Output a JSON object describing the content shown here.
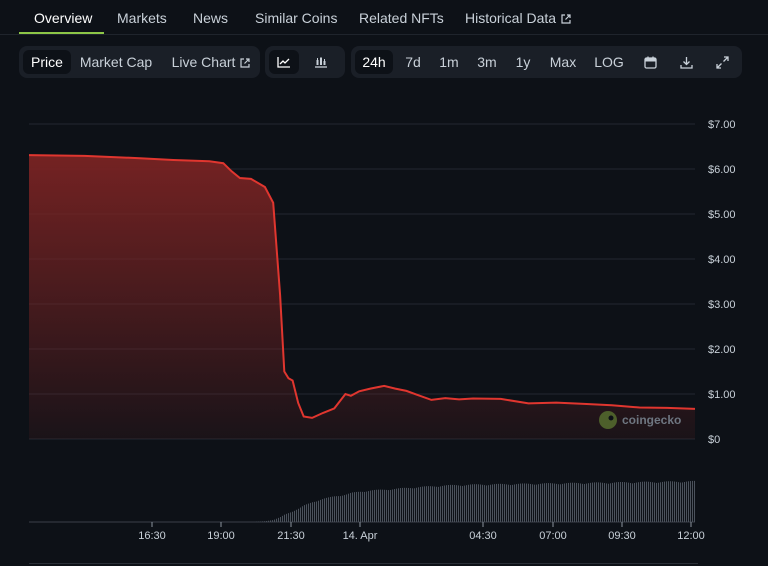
{
  "tabs": [
    {
      "label": "Overview",
      "active": true
    },
    {
      "label": "Markets"
    },
    {
      "label": "News"
    },
    {
      "label": "Similar Coins"
    },
    {
      "label": "Related NFTs"
    },
    {
      "label": "Historical Data",
      "external": true
    }
  ],
  "toolbar": {
    "metric_tabs": [
      "Price",
      "Market Cap",
      "Live Chart"
    ],
    "range_tabs": [
      "24h",
      "7d",
      "1m",
      "3m",
      "1y",
      "Max",
      "LOG"
    ],
    "icons": [
      "line-chart-icon",
      "candlestick-icon",
      "calendar-icon",
      "download-icon",
      "expand-icon"
    ]
  },
  "chart_data": {
    "type": "area",
    "title": "",
    "xlabel": "",
    "ylabel": "",
    "x_ticks": [
      "16:30",
      "19:00",
      "21:30",
      "14. Apr",
      "04:30",
      "07:00",
      "09:30",
      "12:00"
    ],
    "y_ticks": [
      "$7.00",
      "$6.00",
      "$5.00",
      "$4.00",
      "$3.00",
      "$2.00",
      "$1.00",
      "$0"
    ],
    "ylim": [
      0,
      7
    ],
    "y_axis_side": "right",
    "grid": true,
    "line_color": "#e0362f",
    "fill_color": "#7a2323",
    "watermark": "coingecko",
    "x_hours_from_start": [
      0,
      2,
      4,
      5.2,
      6.5,
      7.0,
      7.3,
      7.6,
      8.0,
      8.5,
      8.8,
      9.05,
      9.2,
      9.35,
      9.5,
      9.7,
      9.9,
      10.2,
      10.6,
      11.0,
      11.4,
      11.6,
      11.9,
      12.3,
      12.8,
      13.2,
      13.6,
      14.0,
      14.5,
      15.0,
      15.5,
      16.0,
      17.0,
      18.0,
      19.0,
      20.0,
      21.0,
      22.0,
      23.0,
      24.0
    ],
    "series": [
      {
        "values": [
          6.31,
          6.29,
          6.24,
          6.2,
          6.17,
          6.13,
          5.95,
          5.8,
          5.78,
          5.6,
          5.25,
          3.2,
          1.5,
          1.35,
          1.3,
          0.8,
          0.5,
          0.47,
          0.58,
          0.68,
          1.0,
          0.96,
          1.06,
          1.12,
          1.18,
          1.12,
          1.07,
          0.98,
          0.87,
          0.91,
          0.88,
          0.9,
          0.89,
          0.79,
          0.81,
          0.78,
          0.75,
          0.7,
          0.69,
          0.67
        ]
      }
    ],
    "volume_values": [
      0,
      0,
      0,
      0,
      0,
      0,
      0,
      0,
      0,
      0.02,
      0.05,
      0.12,
      0.18,
      0.22,
      0.26,
      0.32,
      0.4,
      0.48,
      0.56,
      0.62,
      0.66,
      0.7,
      0.73,
      0.76,
      0.78,
      0.8,
      0.82,
      0.84,
      0.86,
      0.88,
      0.89,
      0.9,
      0.91,
      0.92,
      0.93,
      0.94,
      0.95,
      0.96,
      0.97,
      0.98
    ]
  }
}
